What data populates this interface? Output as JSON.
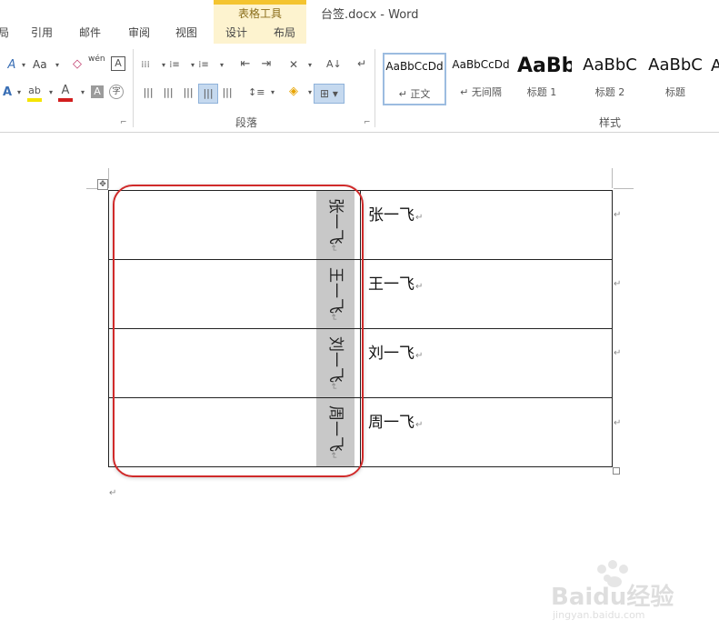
{
  "window": {
    "title": "台签.docx - Word",
    "contextual_group": "表格工具"
  },
  "tabs": [
    "引用",
    "邮件",
    "审阅",
    "视图",
    "设计",
    "布局"
  ],
  "ribbon": {
    "font_size_btn": "Aa",
    "phonetic_btn": "wén",
    "paragraph_label": "段落",
    "styles_label": "样式",
    "styles": [
      {
        "sample": "AaBbCcDd",
        "name": "↵ 正文"
      },
      {
        "sample": "AaBbCcDd",
        "name": "↵ 无间隔"
      },
      {
        "sample": "AaBb",
        "name": "标题 1"
      },
      {
        "sample": "AaBbC",
        "name": "标题 2"
      },
      {
        "sample": "AaBbC",
        "name": "标题"
      }
    ]
  },
  "table": {
    "rows": [
      {
        "vertical": "张一飞",
        "text": "张一飞"
      },
      {
        "vertical": "王一飞",
        "text": "王一飞"
      },
      {
        "vertical": "刘一飞",
        "text": "刘一飞"
      },
      {
        "vertical": "周一飞",
        "text": "周一飞"
      }
    ]
  },
  "marks": {
    "paragraph": "↵"
  },
  "watermark": {
    "text": "Baidu经验",
    "url": "jingyan.baidu.com"
  },
  "colors": {
    "context_tab": "#fdf3cf",
    "context_accent": "#f4c430",
    "highlight": "#d02a2a",
    "shading": "#c8c8c8"
  }
}
